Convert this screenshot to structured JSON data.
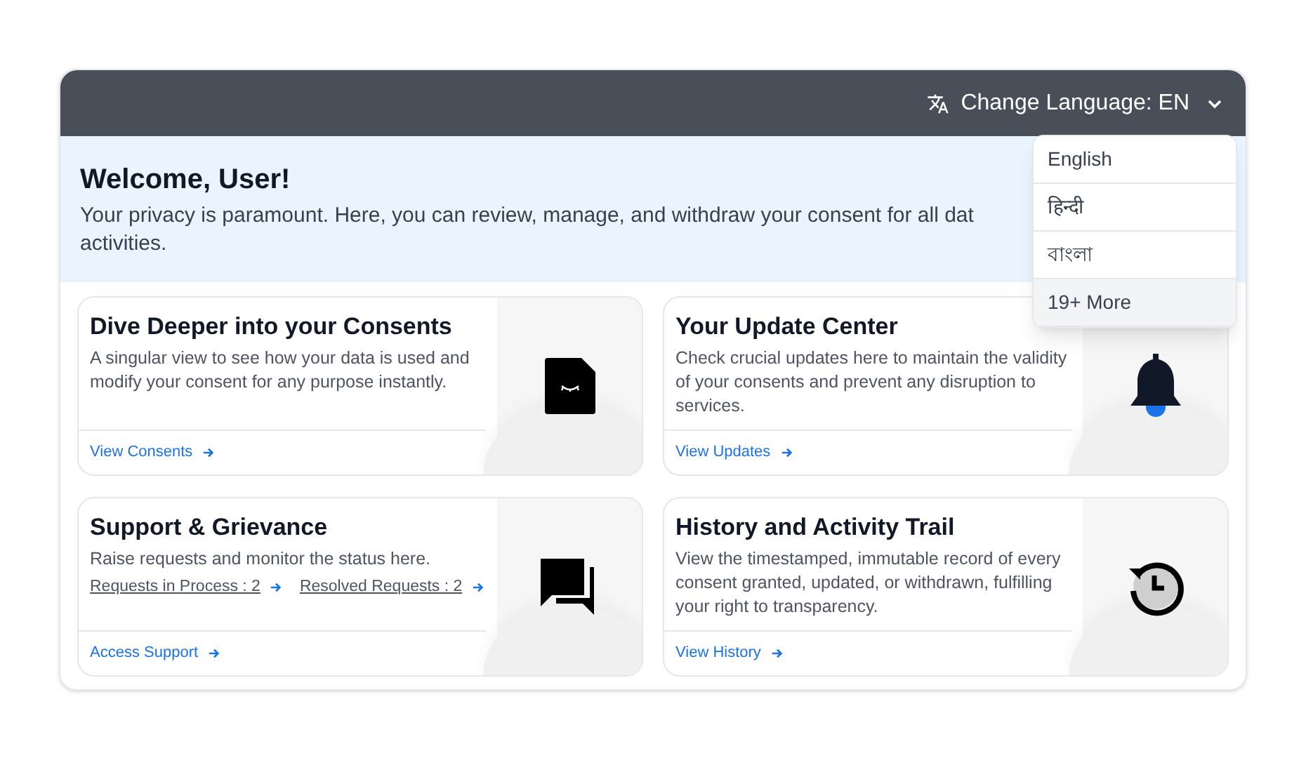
{
  "header": {
    "language_button": "Change Language: EN",
    "dropdown_open": true
  },
  "language_menu": [
    {
      "label": "English",
      "highlighted": false
    },
    {
      "label": "हिन्दी",
      "highlighted": false
    },
    {
      "label": "বাংলা",
      "highlighted": false
    },
    {
      "label": "19+ More",
      "highlighted": true
    }
  ],
  "welcome": {
    "title": "Welcome, User!",
    "lines": [
      "Your privacy is paramount. Here, you can review, manage, and withdraw your consent for all dat",
      "activities."
    ]
  },
  "cards": [
    {
      "title": "Dive Deeper into your Consents",
      "description": "A singular view to see how your data is used and modify your consent for any purpose instantly.",
      "link": "View Consents"
    },
    {
      "title": "Your Update Center",
      "description": "Check crucial updates here to maintain the validity of your consents and prevent any disruption to services.",
      "link": "View Updates"
    },
    {
      "title": "Support & Grievance",
      "description": "Raise requests and monitor the status here.",
      "sublinks": [
        "Requests in Process : 2",
        "Resolved Requests : 2"
      ],
      "link": "Access Support"
    },
    {
      "title": "History and Activity Trail",
      "description": "View the timestamped, immutable record of every consent granted, updated, or withdrawn, fulfilling your right to transparency.",
      "link": "View History"
    }
  ]
}
